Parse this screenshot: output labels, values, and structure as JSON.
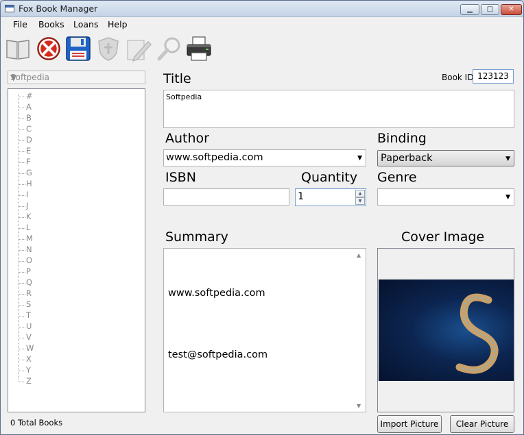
{
  "window": {
    "title": "Fox Book Manager"
  },
  "menu": {
    "items": [
      "File",
      "Books",
      "Loans",
      "Help"
    ]
  },
  "toolbar": {
    "tools": [
      "open-book-icon",
      "delete-icon",
      "save-icon",
      "shield-icon",
      "edit-icon",
      "search-icon",
      "printer-icon"
    ]
  },
  "left": {
    "combo_value": "Softpedia",
    "tree": [
      "#",
      "A",
      "B",
      "C",
      "D",
      "E",
      "F",
      "G",
      "H",
      "I",
      "J",
      "K",
      "L",
      "M",
      "N",
      "O",
      "P",
      "Q",
      "R",
      "S",
      "T",
      "U",
      "V",
      "W",
      "X",
      "Y",
      "Z"
    ],
    "total": "0 Total Books"
  },
  "form": {
    "title_label": "Title",
    "title_value": "Softpedia",
    "book_id_label": "Book ID",
    "book_id_value": "123123",
    "author_label": "Author",
    "author_value": "www.softpedia.com",
    "binding_label": "Binding",
    "binding_value": "Paperback",
    "isbn_label": "ISBN",
    "isbn_value": "",
    "quantity_label": "Quantity",
    "quantity_value": "1",
    "genre_label": "Genre",
    "genre_value": "",
    "summary_label": "Summary",
    "summary_line1": "www.softpedia.com",
    "summary_line2": "test@softpedia.com",
    "cover_label": "Cover Image",
    "import_button": "Import Picture",
    "clear_button": "Clear Picture"
  }
}
